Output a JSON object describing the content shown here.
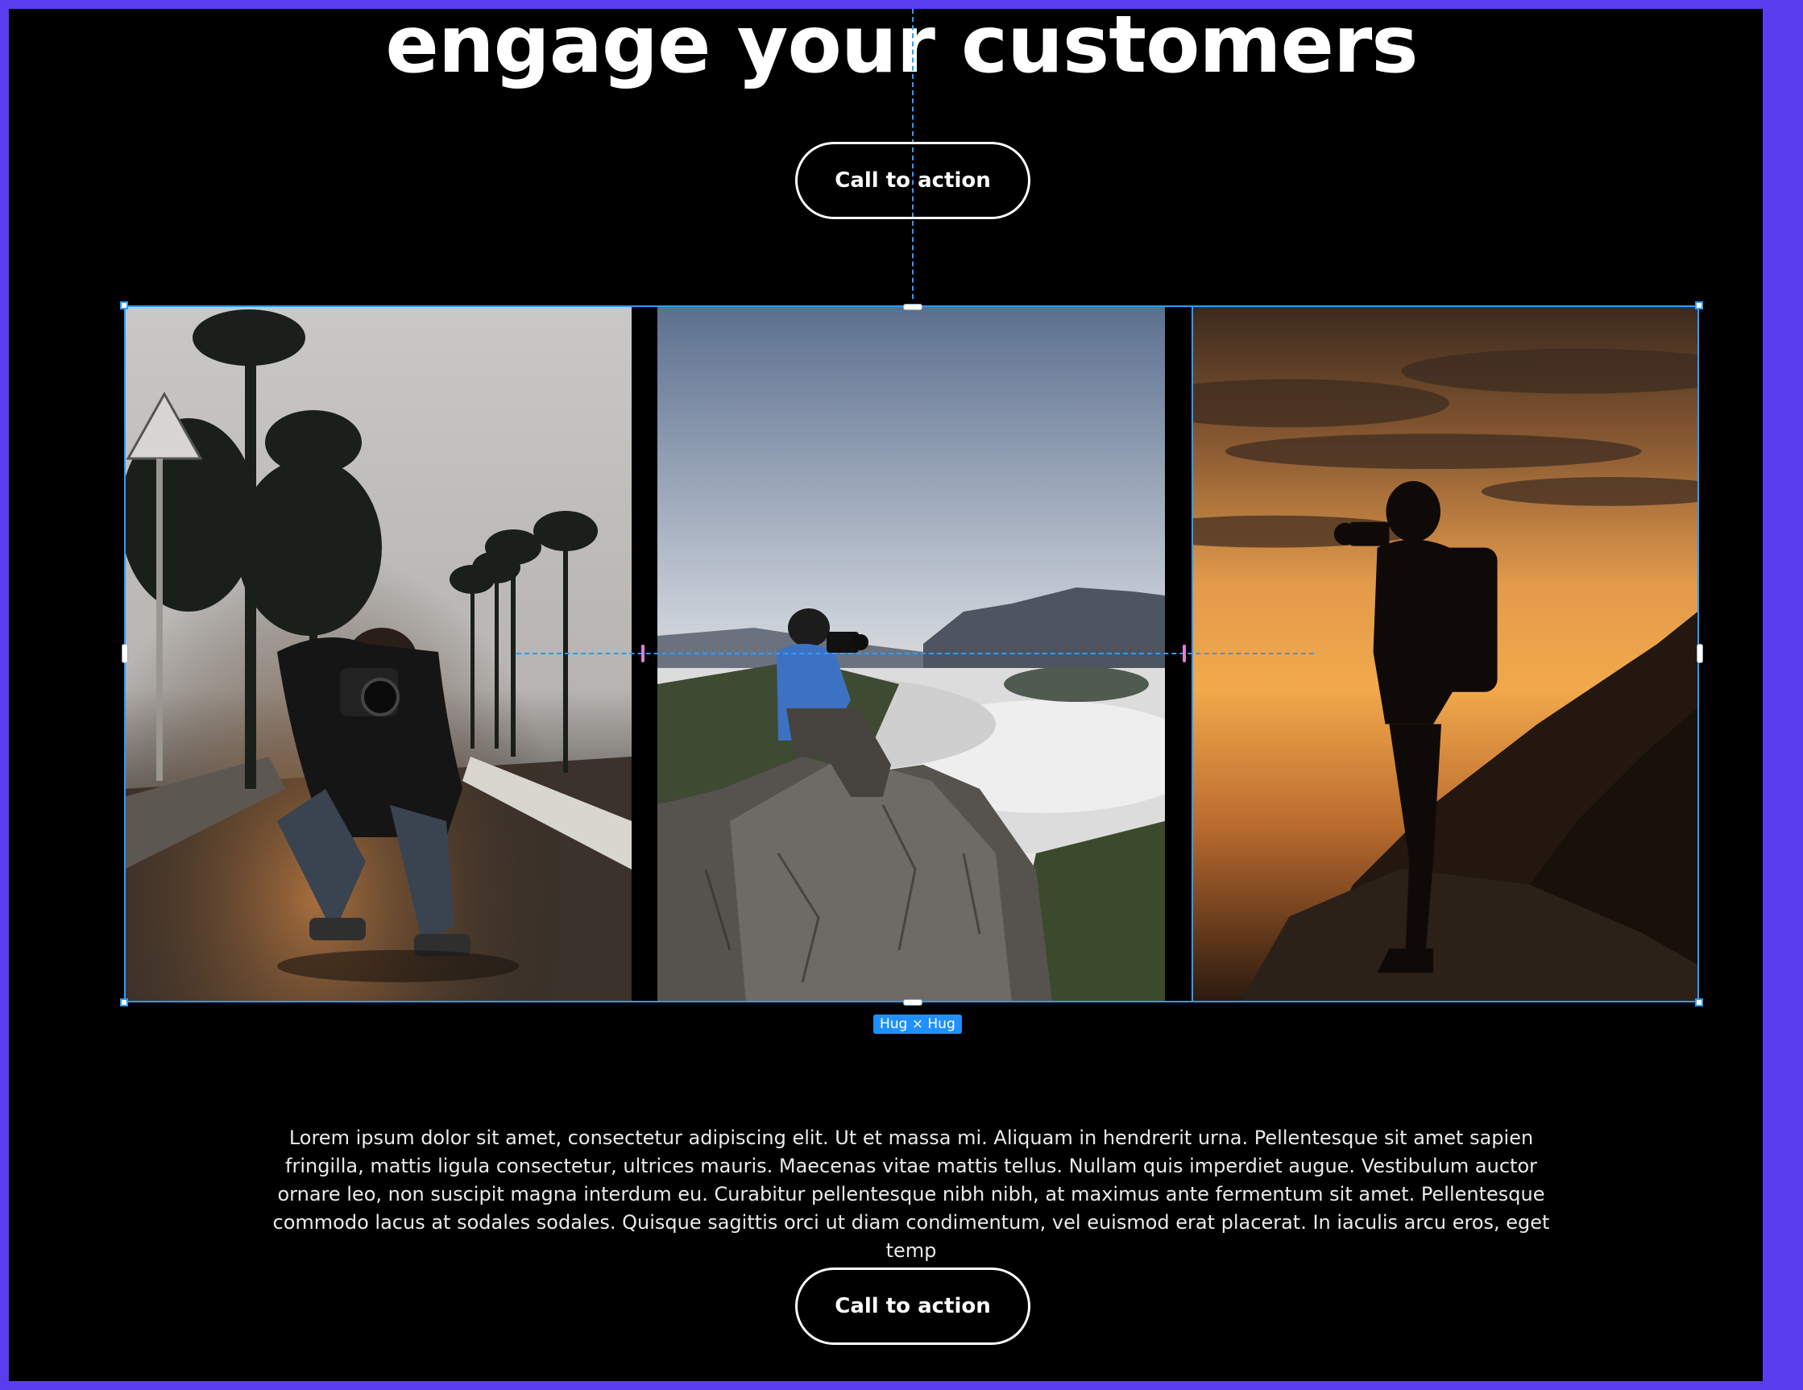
{
  "hero": {
    "headline": "engage your customers",
    "cta_top_label": "Call to action"
  },
  "gallery": {
    "photos": [
      {
        "name": "photographer crouching on street with palm trees"
      },
      {
        "name": "hiker photographing over sea of clouds from rock"
      },
      {
        "name": "silhouetted photographer at sunset on cliff"
      }
    ],
    "badge_label": "Hug × Hug"
  },
  "content": {
    "body_text": "Lorem ipsum dolor sit amet, consectetur adipiscing elit. Ut et massa mi. Aliquam in hendrerit urna. Pellentesque sit amet sapien fringilla, mattis ligula consectetur, ultrices mauris. Maecenas vitae mattis tellus. Nullam quis imperdiet augue. Vestibulum auctor ornare leo, non suscipit magna interdum eu. Curabitur pellentesque nibh nibh, at maximus ante fermentum sit amet. Pellentesque commodo lacus at sodales sodales. Quisque sagittis orci ut diam condimentum, vel euismod erat placerat. In iaculis arcu eros, eget temp",
    "cta_bottom_label": "Call to action"
  },
  "colors": {
    "frame_border": "#5b3df0",
    "background": "#000000",
    "selection": "#2f9bff",
    "badge": "#1e90ff",
    "gap_marker": "#e07fd0"
  }
}
